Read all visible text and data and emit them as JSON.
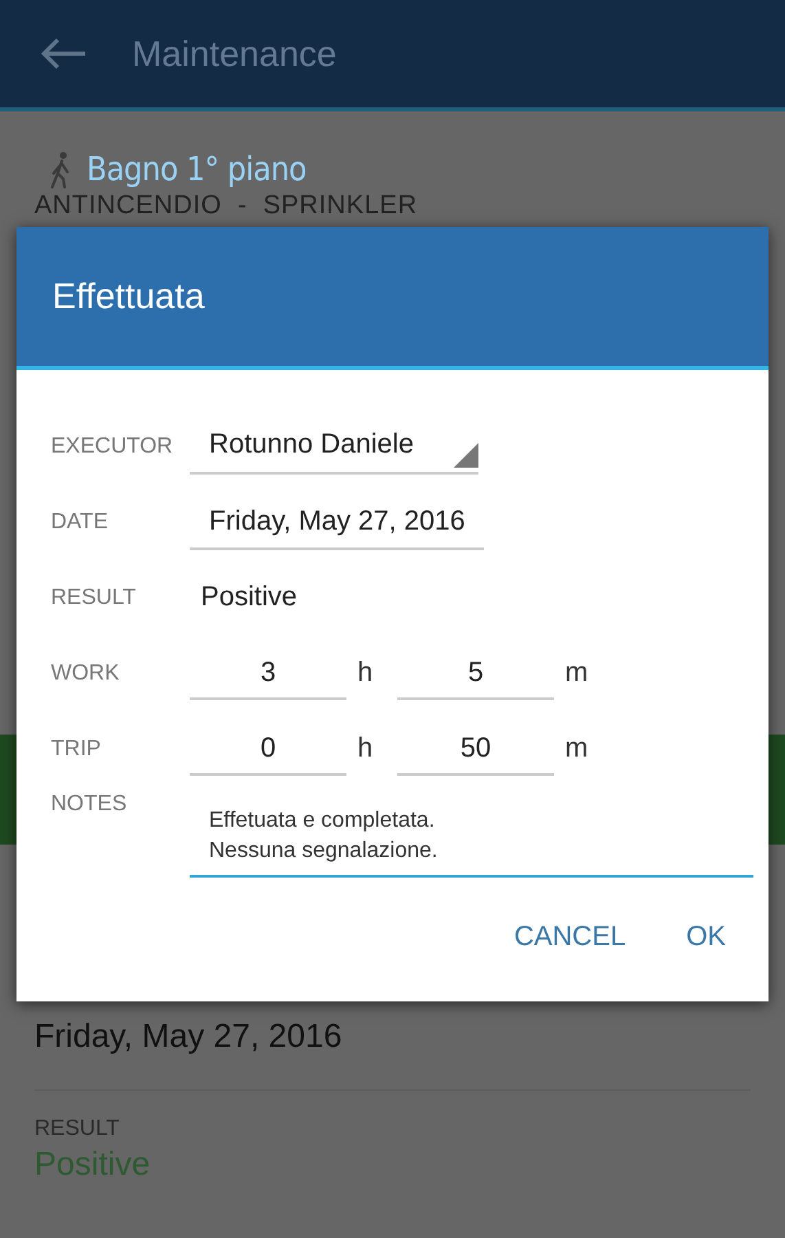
{
  "app_bar": {
    "title": "Maintenance"
  },
  "background": {
    "location": "Bagno 1° piano",
    "category": "ANTINCENDIO  -  SPRINKLER",
    "fields": [
      {
        "kind": "plain",
        "value": "Friday, May 27, 2016"
      },
      {
        "kind": "positive",
        "label": "RESULT",
        "value": "Positive"
      }
    ]
  },
  "dialog": {
    "title": "Effettuata",
    "rows": [
      {
        "kind": "dropdown",
        "label": "EXECUTOR",
        "value": "Rotunno Daniele"
      },
      {
        "kind": "field",
        "label": "DATE",
        "value": "Friday, May 27, 2016"
      },
      {
        "kind": "text",
        "label": "RESULT",
        "value": "Positive"
      },
      {
        "kind": "duration",
        "label": "WORK",
        "hours": "3",
        "hours_unit": "h",
        "minutes": "5",
        "minutes_unit": "m"
      },
      {
        "kind": "duration",
        "label": "TRIP",
        "hours": "0",
        "hours_unit": "h",
        "minutes": "50",
        "minutes_unit": "m"
      },
      {
        "kind": "notes",
        "label": "NOTES",
        "value": "Effetuata e completata.\nNessuna segnalazione.",
        "focused": true
      }
    ],
    "buttons": [
      "CANCEL",
      "OK"
    ]
  }
}
